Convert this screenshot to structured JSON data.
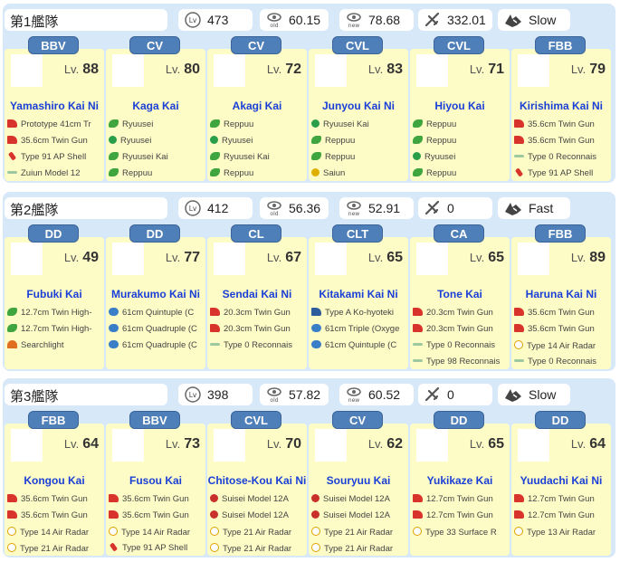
{
  "fleets": [
    {
      "name": "第1艦隊",
      "level": "473",
      "old_los": "60.15",
      "new_los": "78.68",
      "air": "332.01",
      "speed": "Slow",
      "ships": [
        {
          "type": "BBV",
          "level": "88",
          "name": "Yamashiro Kai Ni",
          "equip": [
            {
              "icon": "gun",
              "name": "Prototype 41cm Tr"
            },
            {
              "icon": "gun",
              "name": "35.6cm Twin Gun"
            },
            {
              "icon": "shell",
              "name": "Type 91 AP Shell"
            },
            {
              "icon": "seaplane",
              "name": "Zuiun Model 12"
            }
          ]
        },
        {
          "type": "CV",
          "level": "80",
          "name": "Kaga Kai",
          "equip": [
            {
              "icon": "plane",
              "name": "Ryuusei"
            },
            {
              "icon": "torp",
              "name": "Ryuusei"
            },
            {
              "icon": "plane",
              "name": "Ryuusei Kai"
            },
            {
              "icon": "plane",
              "name": "Reppuu"
            }
          ]
        },
        {
          "type": "CV",
          "level": "72",
          "name": "Akagi Kai",
          "equip": [
            {
              "icon": "plane",
              "name": "Reppuu"
            },
            {
              "icon": "torp",
              "name": "Ryuusei"
            },
            {
              "icon": "plane",
              "name": "Ryuusei Kai"
            },
            {
              "icon": "plane",
              "name": "Reppuu"
            }
          ]
        },
        {
          "type": "CVL",
          "level": "83",
          "name": "Junyou Kai Ni",
          "equip": [
            {
              "icon": "torp",
              "name": "Ryuusei Kai"
            },
            {
              "icon": "plane",
              "name": "Reppuu"
            },
            {
              "icon": "plane",
              "name": "Reppuu"
            },
            {
              "icon": "recon",
              "name": "Saiun"
            }
          ]
        },
        {
          "type": "CVL",
          "level": "71",
          "name": "Hiyou Kai",
          "equip": [
            {
              "icon": "plane",
              "name": "Reppuu"
            },
            {
              "icon": "plane",
              "name": "Reppuu"
            },
            {
              "icon": "torp",
              "name": "Ryuusei"
            },
            {
              "icon": "plane",
              "name": "Reppuu"
            }
          ]
        },
        {
          "type": "FBB",
          "level": "79",
          "name": "Kirishima Kai Ni",
          "equip": [
            {
              "icon": "gun",
              "name": "35.6cm Twin Gun"
            },
            {
              "icon": "gun",
              "name": "35.6cm Twin Gun"
            },
            {
              "icon": "seaplane",
              "name": "Type 0 Reconnais"
            },
            {
              "icon": "shell",
              "name": "Type 91 AP Shell"
            }
          ]
        }
      ]
    },
    {
      "name": "第2艦隊",
      "level": "412",
      "old_los": "56.36",
      "new_los": "52.91",
      "air": "0",
      "speed": "Fast",
      "ships": [
        {
          "type": "DD",
          "level": "49",
          "name": "Fubuki Kai",
          "equip": [
            {
              "icon": "plane",
              "name": "12.7cm Twin High-"
            },
            {
              "icon": "plane",
              "name": "12.7cm Twin High-"
            },
            {
              "icon": "light",
              "name": "Searchlight"
            },
            {
              "icon": "",
              "name": ""
            }
          ]
        },
        {
          "type": "DD",
          "level": "77",
          "name": "Murakumo Kai Ni",
          "equip": [
            {
              "icon": "tpd",
              "name": "61cm Quintuple (C"
            },
            {
              "icon": "tpd",
              "name": "61cm Quadruple (C"
            },
            {
              "icon": "tpd",
              "name": "61cm Quadruple (C"
            },
            {
              "icon": "",
              "name": ""
            }
          ]
        },
        {
          "type": "CL",
          "level": "67",
          "name": "Sendai Kai Ni",
          "equip": [
            {
              "icon": "gun",
              "name": "20.3cm Twin Gun"
            },
            {
              "icon": "gun",
              "name": "20.3cm Twin Gun"
            },
            {
              "icon": "seaplane",
              "name": "Type 0 Reconnais"
            },
            {
              "icon": "",
              "name": ""
            }
          ]
        },
        {
          "type": "CLT",
          "level": "65",
          "name": "Kitakami Kai Ni",
          "equip": [
            {
              "icon": "sm",
              "name": "Type A Ko-hyoteki"
            },
            {
              "icon": "tpd",
              "name": "61cm Triple (Oxyge"
            },
            {
              "icon": "tpd",
              "name": "61cm Quintuple (C"
            },
            {
              "icon": "",
              "name": ""
            }
          ]
        },
        {
          "type": "CA",
          "level": "65",
          "name": "Tone Kai",
          "equip": [
            {
              "icon": "gun",
              "name": "20.3cm Twin Gun"
            },
            {
              "icon": "gun",
              "name": "20.3cm Twin Gun"
            },
            {
              "icon": "seaplane",
              "name": "Type 0 Reconnais"
            },
            {
              "icon": "seaplane",
              "name": "Type 98 Reconnais"
            }
          ]
        },
        {
          "type": "FBB",
          "level": "89",
          "name": "Haruna Kai Ni",
          "equip": [
            {
              "icon": "gun",
              "name": "35.6cm Twin Gun"
            },
            {
              "icon": "gun",
              "name": "35.6cm Twin Gun"
            },
            {
              "icon": "radar",
              "name": "Type 14 Air Radar"
            },
            {
              "icon": "seaplane",
              "name": "Type 0 Reconnais"
            }
          ]
        }
      ]
    },
    {
      "name": "第3艦隊",
      "level": "398",
      "old_los": "57.82",
      "new_los": "60.52",
      "air": "0",
      "speed": "Slow",
      "ships": [
        {
          "type": "FBB",
          "level": "64",
          "name": "Kongou Kai",
          "equip": [
            {
              "icon": "gun",
              "name": "35.6cm Twin Gun"
            },
            {
              "icon": "gun",
              "name": "35.6cm Twin Gun"
            },
            {
              "icon": "radar",
              "name": "Type 14 Air Radar"
            },
            {
              "icon": "radar",
              "name": "Type 21 Air Radar"
            }
          ]
        },
        {
          "type": "BBV",
          "level": "73",
          "name": "Fusou Kai",
          "equip": [
            {
              "icon": "gun",
              "name": "35.6cm Twin Gun"
            },
            {
              "icon": "gun",
              "name": "35.6cm Twin Gun"
            },
            {
              "icon": "radar",
              "name": "Type 14 Air Radar"
            },
            {
              "icon": "shell",
              "name": "Type 91 AP Shell"
            }
          ]
        },
        {
          "type": "CVL",
          "level": "70",
          "name": "Chitose-Kou Kai Ni",
          "equip": [
            {
              "icon": "bomber",
              "name": "Suisei Model 12A"
            },
            {
              "icon": "bomber",
              "name": "Suisei Model 12A"
            },
            {
              "icon": "radar",
              "name": "Type 21 Air Radar"
            },
            {
              "icon": "radar",
              "name": "Type 21 Air Radar"
            }
          ]
        },
        {
          "type": "CV",
          "level": "62",
          "name": "Souryuu Kai",
          "equip": [
            {
              "icon": "bomber",
              "name": "Suisei Model 12A"
            },
            {
              "icon": "bomber",
              "name": "Suisei Model 12A"
            },
            {
              "icon": "radar",
              "name": "Type 21 Air Radar"
            },
            {
              "icon": "radar",
              "name": "Type 21 Air Radar"
            }
          ]
        },
        {
          "type": "DD",
          "level": "65",
          "name": "Yukikaze Kai",
          "equip": [
            {
              "icon": "gun",
              "name": "12.7cm Twin Gun"
            },
            {
              "icon": "gun",
              "name": "12.7cm Twin Gun"
            },
            {
              "icon": "radar",
              "name": "Type 33 Surface R"
            },
            {
              "icon": "",
              "name": ""
            }
          ]
        },
        {
          "type": "DD",
          "level": "64",
          "name": "Yuudachi Kai Ni",
          "equip": [
            {
              "icon": "gun",
              "name": "12.7cm Twin Gun"
            },
            {
              "icon": "gun",
              "name": "12.7cm Twin Gun"
            },
            {
              "icon": "radar",
              "name": "Type 13 Air Radar"
            },
            {
              "icon": "",
              "name": ""
            }
          ]
        }
      ]
    }
  ],
  "labels": {
    "lv_prefix": "Lv.",
    "lv_icon": "Lv",
    "old_tag": "old",
    "new_tag": "new"
  },
  "colors": {
    "panel_bg": "#d7e8f8",
    "card_bg": "#fefcc6",
    "type_badge": "#4f7fb8",
    "ship_name": "#1a3fd6"
  }
}
